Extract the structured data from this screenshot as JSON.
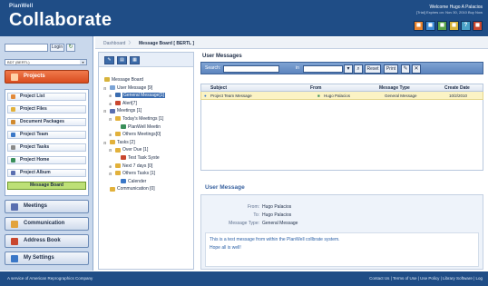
{
  "header": {
    "brand_small": "PlanWell",
    "brand_large": "Collaborate",
    "welcome": "Welcome Hugo A Palacios",
    "welcome_sub": "[Trial] Expires on: Nov 30, 2010 Buy Now",
    "icons": [
      {
        "name": "profile-icon",
        "color": "#e8832e",
        "glyph": "◼"
      },
      {
        "name": "contacts-icon",
        "color": "#3f8cd6",
        "glyph": "◼"
      },
      {
        "name": "print-icon",
        "color": "#5aa34a",
        "glyph": "◼"
      },
      {
        "name": "tools-icon",
        "color": "#d7b33b",
        "glyph": "◼"
      },
      {
        "name": "help-icon",
        "color": "#4aa3c8",
        "glyph": "?"
      },
      {
        "name": "logout-icon",
        "color": "#c9472f",
        "glyph": "◼"
      }
    ]
  },
  "left": {
    "login_button": "Login",
    "group_select": "BDT (BERTL)",
    "projects_label": "Projects",
    "nav_items": [
      {
        "label": "Project List",
        "color": "#e28a3b"
      },
      {
        "label": "Project Files",
        "color": "#e2b13b"
      },
      {
        "label": "Document Packages",
        "color": "#d0892e"
      },
      {
        "label": "Project Team",
        "color": "#3a77c7"
      },
      {
        "label": "Project Tasks",
        "color": "#8a8a8a"
      },
      {
        "label": "Project Home",
        "color": "#3a8f5a"
      },
      {
        "label": "Project Album",
        "color": "#5a6fb0"
      },
      {
        "label": "Message Board",
        "color": "#6f9a2e"
      }
    ],
    "sections": [
      {
        "label": "Meetings",
        "color": "#5a6fb0"
      },
      {
        "label": "Communication",
        "color": "#e2a33b"
      },
      {
        "label": "Address Book",
        "color": "#c9472f"
      },
      {
        "label": "My Settings",
        "color": "#3a77c7"
      }
    ]
  },
  "breadcrumb": {
    "root": "Dashboard",
    "current": "Message Board [ BERTL ]"
  },
  "tree": {
    "items": [
      {
        "label": "Message Board",
        "color": "#d7b33b"
      },
      {
        "label": "User Message [9]",
        "color": "#7aa3d6"
      },
      {
        "label": "General Message[1]",
        "color": "#3a6cb0"
      },
      {
        "label": "Alert[7]",
        "color": "#c9472f"
      },
      {
        "label": "Meetings [1]",
        "color": "#5a6fb0"
      },
      {
        "label": "Today's Meetings [1]",
        "color": "#e2b13b"
      },
      {
        "label": "PlanWell Meetin",
        "color": "#3a8f5a"
      },
      {
        "label": "Others Meetings[0]",
        "color": "#e2b13b"
      },
      {
        "label": "Tasks [2]",
        "color": "#e2b13b"
      },
      {
        "label": "Over Due [1]",
        "color": "#e2b13b"
      },
      {
        "label": "Test Task Syste",
        "color": "#c9472f"
      },
      {
        "label": "Next 7 days [0]",
        "color": "#e2b13b"
      },
      {
        "label": "Others Tasks [1]",
        "color": "#e2b13b"
      },
      {
        "label": "Calender",
        "color": "#3a77c7"
      },
      {
        "label": "Communication [0]",
        "color": "#e2b13b"
      }
    ]
  },
  "messages": {
    "title": "User Messages",
    "search_label": "Search:",
    "in_label": "in",
    "reset_label": "Reset",
    "print_label": "Print",
    "columns": [
      "Subject",
      "From",
      "Message Type",
      "Create Date"
    ],
    "rows": [
      {
        "subject": "Project Team Message",
        "from": "Hugo Palacios",
        "type": "General Message",
        "date": "10/2/2010"
      }
    ]
  },
  "user_message": {
    "title": "User Message",
    "from_label": "From:",
    "from": "Hugo Palacios",
    "to_label": "To:",
    "to": "Hugo Palacios",
    "type_label": "Message Type:",
    "type": "General Message",
    "body_line1": "This is a test message from within the PlanWell collbrate system.",
    "body_line2": "Hope all is well!"
  },
  "footer": {
    "left": "A service of American Reprographics Company",
    "right": "Contact Us | Terms of Use | Use Policy | Library Software | Log"
  }
}
